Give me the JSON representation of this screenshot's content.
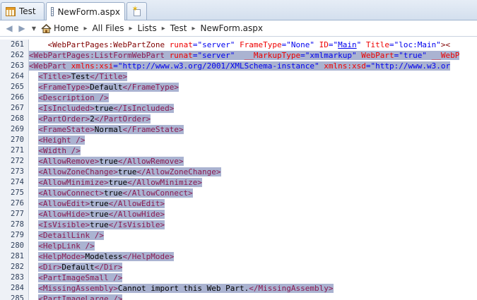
{
  "tabs": [
    {
      "label": "Test",
      "icon": "site-grid-icon"
    },
    {
      "label": "NewForm.aspx",
      "icon": "page-icon"
    }
  ],
  "breadcrumb": [
    "Home",
    "All Files",
    "Lists",
    "Test",
    "NewForm.aspx"
  ],
  "editor": {
    "lines": [
      {
        "num": "261",
        "sel": false,
        "indent": "    ",
        "segs": [
          {
            "c": "t",
            "t": "<WebPartPages:WebPartZone"
          },
          {
            "c": "x",
            "t": " "
          },
          {
            "c": "a",
            "t": "runat"
          },
          {
            "c": "p",
            "t": "="
          },
          {
            "c": "v",
            "t": "\"server\""
          },
          {
            "c": "x",
            "t": " "
          },
          {
            "c": "a",
            "t": "FrameType"
          },
          {
            "c": "p",
            "t": "="
          },
          {
            "c": "v",
            "t": "\"None\""
          },
          {
            "c": "x",
            "t": " "
          },
          {
            "c": "a",
            "t": "ID"
          },
          {
            "c": "p",
            "t": "="
          },
          {
            "c": "v",
            "t": "\""
          },
          {
            "c": "vu",
            "t": "Main"
          },
          {
            "c": "v",
            "t": "\""
          },
          {
            "c": "x",
            "t": " "
          },
          {
            "c": "a",
            "t": "Title"
          },
          {
            "c": "p",
            "t": "="
          },
          {
            "c": "v",
            "t": "\"loc:Main\""
          },
          {
            "c": "t",
            "t": "><"
          }
        ]
      },
      {
        "num": "262",
        "sel": true,
        "indent": "",
        "segs": [
          {
            "c": "t",
            "t": "<WebPartPages:ListFormWebPart"
          },
          {
            "c": "x",
            "t": " "
          },
          {
            "c": "a",
            "t": "runat"
          },
          {
            "c": "p",
            "t": "="
          },
          {
            "c": "v",
            "t": "\"server\""
          },
          {
            "c": "x",
            "t": "  "
          },
          {
            "c": "a",
            "t": "__MarkupType"
          },
          {
            "c": "p",
            "t": "="
          },
          {
            "c": "v",
            "t": "\"xmlmarkup\""
          },
          {
            "c": "x",
            "t": " "
          },
          {
            "c": "a",
            "t": "WebPart"
          },
          {
            "c": "p",
            "t": "="
          },
          {
            "c": "v",
            "t": "\"true\""
          },
          {
            "c": "x",
            "t": " "
          },
          {
            "c": "a",
            "t": "__WebP"
          }
        ]
      },
      {
        "num": "263",
        "sel": true,
        "indent": "",
        "segs": [
          {
            "c": "t",
            "t": "<WebPart"
          },
          {
            "c": "x",
            "t": " "
          },
          {
            "c": "a",
            "t": "xmlns:xsi"
          },
          {
            "c": "p",
            "t": "="
          },
          {
            "c": "v",
            "t": "\"http://www.w3.org/2001/XMLSchema-instance\""
          },
          {
            "c": "x",
            "t": " "
          },
          {
            "c": "a",
            "t": "xmlns:xsd"
          },
          {
            "c": "p",
            "t": "="
          },
          {
            "c": "v",
            "t": "\"http://www.w3.or"
          }
        ]
      },
      {
        "num": "264",
        "sel": true,
        "indent": "  ",
        "segs": [
          {
            "c": "t",
            "t": "<Title>"
          },
          {
            "c": "x",
            "t": "Test"
          },
          {
            "c": "t",
            "t": "</Title>"
          }
        ]
      },
      {
        "num": "265",
        "sel": true,
        "indent": "  ",
        "segs": [
          {
            "c": "t",
            "t": "<FrameType>"
          },
          {
            "c": "x",
            "t": "Default"
          },
          {
            "c": "t",
            "t": "</FrameType>"
          }
        ]
      },
      {
        "num": "266",
        "sel": true,
        "indent": "  ",
        "segs": [
          {
            "c": "t",
            "t": "<Description />"
          }
        ]
      },
      {
        "num": "267",
        "sel": true,
        "indent": "  ",
        "segs": [
          {
            "c": "t",
            "t": "<IsIncluded>"
          },
          {
            "c": "x",
            "t": "true"
          },
          {
            "c": "t",
            "t": "</IsIncluded>"
          }
        ]
      },
      {
        "num": "268",
        "sel": true,
        "indent": "  ",
        "segs": [
          {
            "c": "t",
            "t": "<PartOrder>"
          },
          {
            "c": "x",
            "t": "2"
          },
          {
            "c": "t",
            "t": "</PartOrder>"
          }
        ]
      },
      {
        "num": "269",
        "sel": true,
        "indent": "  ",
        "segs": [
          {
            "c": "t",
            "t": "<FrameState>"
          },
          {
            "c": "x",
            "t": "Normal"
          },
          {
            "c": "t",
            "t": "</FrameState>"
          }
        ]
      },
      {
        "num": "270",
        "sel": true,
        "indent": "  ",
        "segs": [
          {
            "c": "t",
            "t": "<Height />"
          }
        ]
      },
      {
        "num": "271",
        "sel": true,
        "indent": "  ",
        "segs": [
          {
            "c": "t",
            "t": "<Width />"
          }
        ]
      },
      {
        "num": "272",
        "sel": true,
        "indent": "  ",
        "segs": [
          {
            "c": "t",
            "t": "<AllowRemove>"
          },
          {
            "c": "x",
            "t": "true"
          },
          {
            "c": "t",
            "t": "</AllowRemove>"
          }
        ]
      },
      {
        "num": "273",
        "sel": true,
        "indent": "  ",
        "segs": [
          {
            "c": "t",
            "t": "<AllowZoneChange>"
          },
          {
            "c": "x",
            "t": "true"
          },
          {
            "c": "t",
            "t": "</AllowZoneChange>"
          }
        ]
      },
      {
        "num": "274",
        "sel": true,
        "indent": "  ",
        "segs": [
          {
            "c": "t",
            "t": "<AllowMinimize>"
          },
          {
            "c": "x",
            "t": "true"
          },
          {
            "c": "t",
            "t": "</AllowMinimize>"
          }
        ]
      },
      {
        "num": "275",
        "sel": true,
        "indent": "  ",
        "segs": [
          {
            "c": "t",
            "t": "<AllowConnect>"
          },
          {
            "c": "x",
            "t": "true"
          },
          {
            "c": "t",
            "t": "</AllowConnect>"
          }
        ]
      },
      {
        "num": "276",
        "sel": true,
        "indent": "  ",
        "segs": [
          {
            "c": "t",
            "t": "<AllowEdit>"
          },
          {
            "c": "x",
            "t": "true"
          },
          {
            "c": "t",
            "t": "</AllowEdit>"
          }
        ]
      },
      {
        "num": "277",
        "sel": true,
        "indent": "  ",
        "segs": [
          {
            "c": "t",
            "t": "<AllowHide>"
          },
          {
            "c": "x",
            "t": "true"
          },
          {
            "c": "t",
            "t": "</AllowHide>"
          }
        ]
      },
      {
        "num": "278",
        "sel": true,
        "indent": "  ",
        "segs": [
          {
            "c": "t",
            "t": "<IsVisible>"
          },
          {
            "c": "x",
            "t": "true"
          },
          {
            "c": "t",
            "t": "</IsVisible>"
          }
        ]
      },
      {
        "num": "279",
        "sel": true,
        "indent": "  ",
        "segs": [
          {
            "c": "t",
            "t": "<DetailLink />"
          }
        ]
      },
      {
        "num": "280",
        "sel": true,
        "indent": "  ",
        "segs": [
          {
            "c": "t",
            "t": "<HelpLink />"
          }
        ]
      },
      {
        "num": "281",
        "sel": true,
        "indent": "  ",
        "segs": [
          {
            "c": "t",
            "t": "<HelpMode>"
          },
          {
            "c": "x",
            "t": "Modeless"
          },
          {
            "c": "t",
            "t": "</HelpMode>"
          }
        ]
      },
      {
        "num": "282",
        "sel": true,
        "indent": "  ",
        "segs": [
          {
            "c": "t",
            "t": "<Dir>"
          },
          {
            "c": "x",
            "t": "Default"
          },
          {
            "c": "t",
            "t": "</Dir>"
          }
        ]
      },
      {
        "num": "283",
        "sel": true,
        "indent": "  ",
        "segs": [
          {
            "c": "t",
            "t": "<PartImageSmall />"
          }
        ]
      },
      {
        "num": "284",
        "sel": true,
        "indent": "  ",
        "segs": [
          {
            "c": "t",
            "t": "<MissingAssembly>"
          },
          {
            "c": "x",
            "t": "Cannot import this Web Part."
          },
          {
            "c": "t",
            "t": "</MissingAssembly>"
          }
        ]
      },
      {
        "num": "285",
        "sel": true,
        "indent": "  ",
        "segs": [
          {
            "c": "t",
            "t": "<PartImageLarge />"
          }
        ]
      }
    ]
  }
}
